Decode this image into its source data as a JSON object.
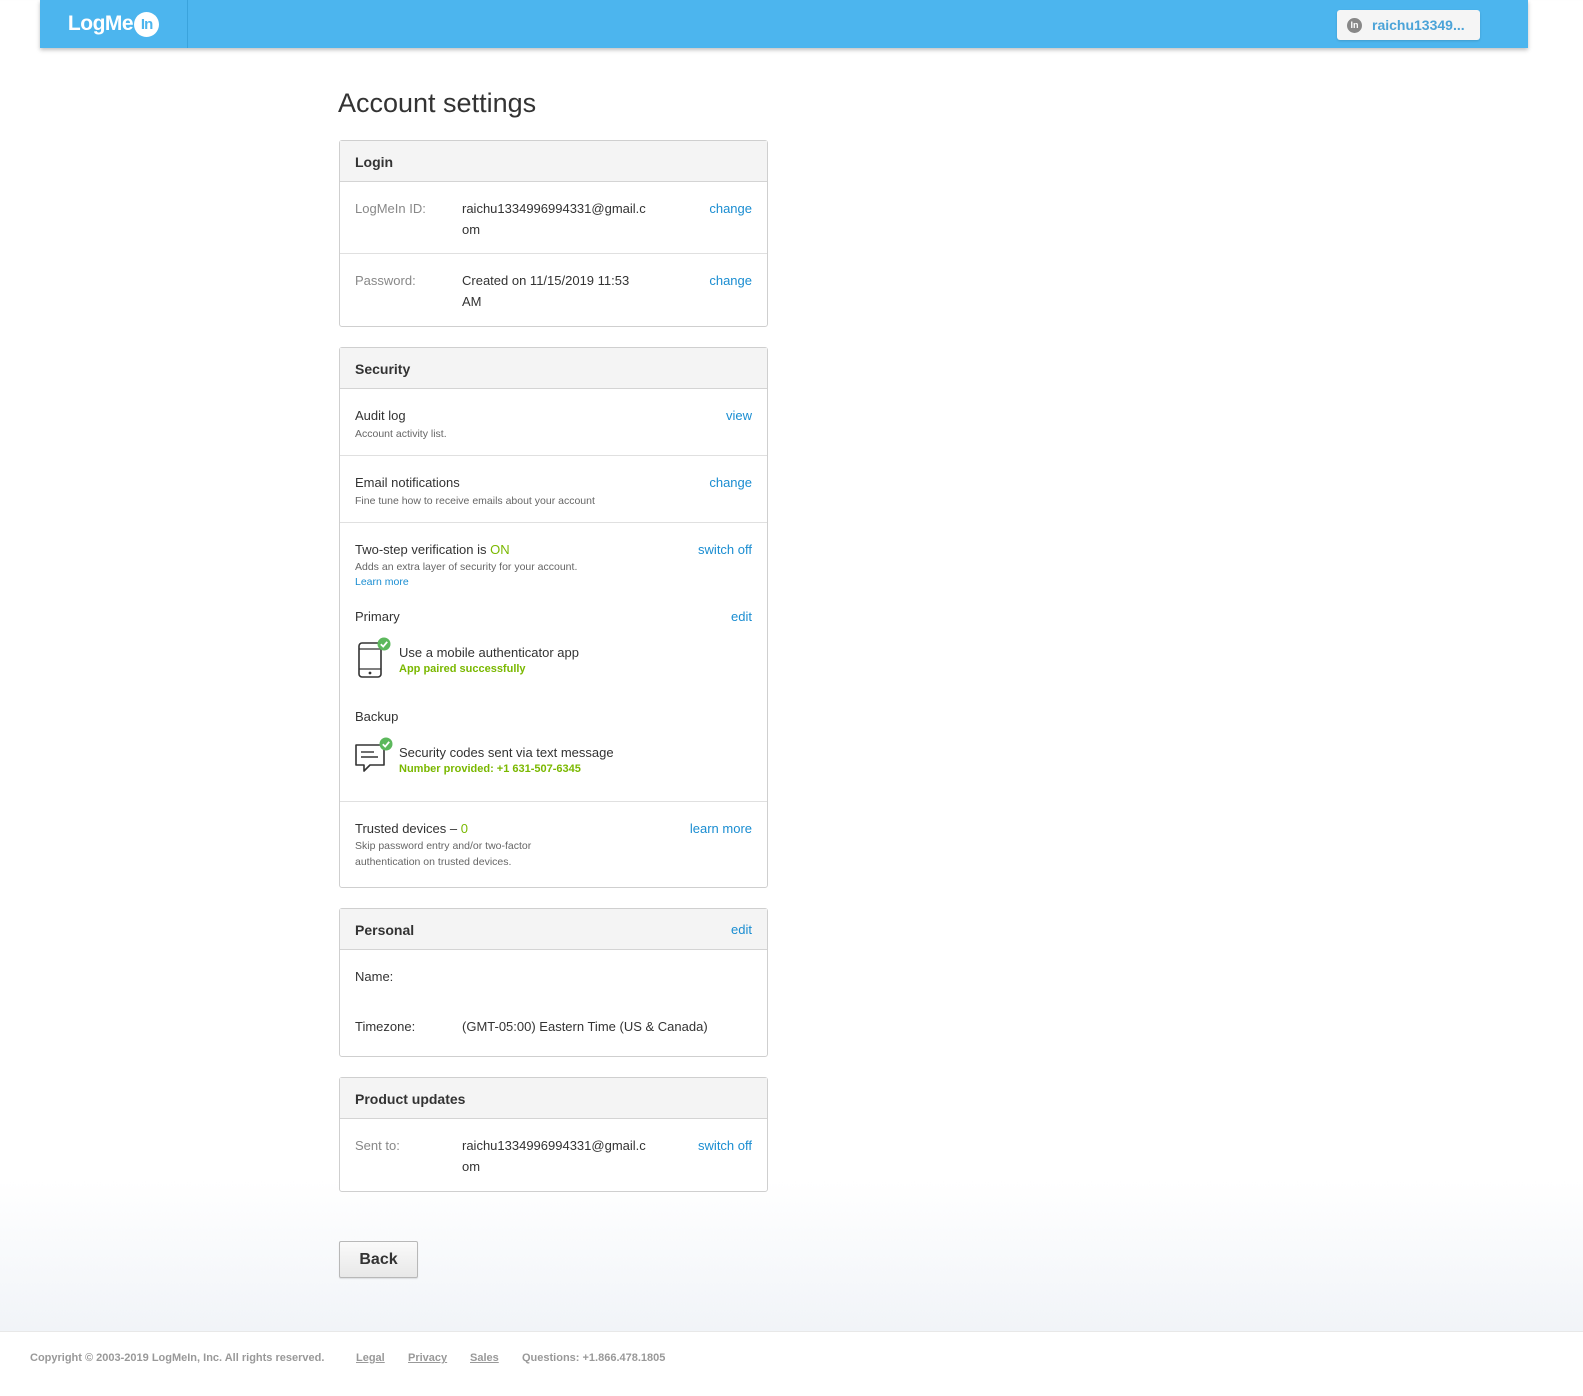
{
  "header": {
    "logo": {
      "text": "LogMe",
      "badge": "In"
    },
    "user": {
      "icon": "In",
      "name": "raichu13349..."
    }
  },
  "page_title": "Account settings",
  "login": {
    "title": "Login",
    "logmein_id": {
      "label": "LogMeIn ID:",
      "value_line1": "raichu1334996994331@gmail.c",
      "value_line2": "om",
      "action": "change"
    },
    "password": {
      "label": "Password:",
      "value_line1": "Created on 11/15/2019 11:53",
      "value_line2": "AM",
      "action": "change"
    }
  },
  "security": {
    "title": "Security",
    "audit": {
      "title": "Audit log",
      "desc": "Account activity list.",
      "action": "view"
    },
    "email": {
      "title": "Email notifications",
      "desc": "Fine tune how to receive emails about your account",
      "action": "change"
    },
    "two_step": {
      "title": "Two-step verification is",
      "status": "ON",
      "desc": "Adds an extra layer of security for your account.",
      "learn_more": "Learn more",
      "action": "switch off",
      "primary": {
        "label": "Primary",
        "action": "edit",
        "method": "Use a mobile authenticator app",
        "status": "App paired successfully",
        "icon": "mobile-phone-check-icon"
      },
      "backup": {
        "label": "Backup",
        "method": "Security codes sent via text message",
        "status": "Number provided: +1 631-507-6345",
        "icon": "text-message-check-icon"
      }
    },
    "trusted": {
      "title": "Trusted devices –",
      "count": "0",
      "desc_line1": "Skip password entry and/or two-factor",
      "desc_line2": "authentication on trusted devices.",
      "action": "learn more"
    }
  },
  "personal": {
    "title": "Personal",
    "action": "edit",
    "name_label": "Name:",
    "timezone_label": "Timezone:",
    "timezone_value": "(GMT-05:00) Eastern Time (US & Canada)"
  },
  "product_updates": {
    "title": "Product updates",
    "label": "Sent to:",
    "value_line1": "raichu1334996994331@gmail.c",
    "value_line2": "om",
    "action": "switch off"
  },
  "back_button": "Back",
  "footer": {
    "copyright": "Copyright © 2003-2019 LogMeIn, Inc. All rights reserved.",
    "legal": "Legal",
    "privacy": "Privacy",
    "sales": "Sales",
    "questions": "Questions: +1.866.478.1805"
  },
  "colors": {
    "header_blue": "#4cb5ee",
    "link_blue": "#1a8dd1",
    "success_green": "#7ab800",
    "check_green": "#5cb85c"
  }
}
